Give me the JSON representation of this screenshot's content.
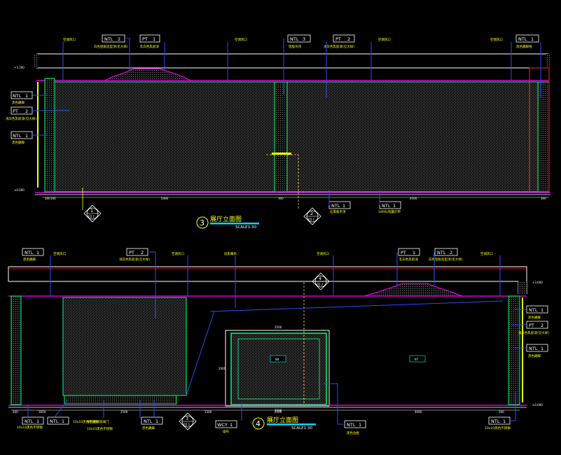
{
  "elevation_3": {
    "title": "展厅立面图",
    "number": "3",
    "scale": "SCALE1:30",
    "level_top": "+3.300",
    "level_base": "±0.000",
    "tags": [
      {
        "code": "NTL",
        "num": "2",
        "note": "白色铝板造型顶(见大样)"
      },
      {
        "code": "PT",
        "num": "1",
        "note": "乳白色乳胶漆"
      },
      {
        "code": "NTL",
        "num": "3",
        "note": "铝板吊顶"
      },
      {
        "code": "PT",
        "num": "2",
        "note": "浅灰色乳胶漆(见大样)"
      },
      {
        "code": "NTL",
        "num": "1",
        "note": "黑色踢脚线"
      }
    ],
    "left_tags": [
      {
        "code": "NTL",
        "num": "1",
        "note": "黑色踢脚"
      },
      {
        "code": "PT",
        "num": "2",
        "note": "浅灰色乳胶漆(见大样)"
      },
      {
        "code": "NTL",
        "num": "1",
        "note": "黑色踢脚"
      }
    ],
    "top_notes": [
      "空调风口",
      "空调风口",
      "空调风口",
      "空调风口"
    ],
    "dims": [
      "200",
      "100",
      "5400",
      "300",
      "4500",
      "300"
    ],
    "bottom_tags": [
      {
        "code": "NTL",
        "num": "1",
        "note": "石膏板吊顶"
      }
    ],
    "bottom_notes": [
      "1800L暗藏灯带"
    ],
    "details": [
      {
        "num": "1",
        "sheet": "FD.1"
      },
      {
        "num": "2",
        "sheet": "FD.1"
      }
    ]
  },
  "elevation_4": {
    "title": "展厅立面图",
    "number": "4",
    "scale": "SCALE1:30",
    "level_top": "+3.000",
    "level_base": "±0.000",
    "tags": [
      {
        "code": "NTL",
        "num": "1",
        "note": "黑色踢脚"
      },
      {
        "code": "PT",
        "num": "2",
        "note": "浅灰色乳胶漆(见大样)"
      },
      {
        "code": "PT",
        "num": "1",
        "note": "乳白色乳胶漆"
      },
      {
        "code": "NTL",
        "num": "2",
        "note": "白色铝板造型顶(见大样)"
      }
    ],
    "top_notes": [
      "空调风口",
      "空调风口",
      "投影幕布",
      "空调风口",
      "空调风口"
    ],
    "right_tags": [
      {
        "code": "NTL",
        "num": "1",
        "note": "黑色踢脚"
      },
      {
        "code": "PT",
        "num": "2",
        "note": "浅灰色乳胶漆(见大样)"
      },
      {
        "code": "NTL",
        "num": "1",
        "note": "黑色踢脚"
      }
    ],
    "dims": [
      "200",
      "1850",
      "2500",
      "1300",
      "2500",
      "4000",
      "200"
    ],
    "bottom_tags": [
      {
        "code": "NTL",
        "num": "1",
        "note": "10x10黑色不锈钢"
      },
      {
        "code": "NTL",
        "num": "1",
        "note": "10x10黑色不锈钢"
      },
      {
        "code": "NTL",
        "num": "1",
        "note": "黑色踢脚"
      },
      {
        "code": "WCY",
        "num": "1",
        "note": "墙布"
      },
      {
        "code": "NTL",
        "num": "1",
        "note": "黑色边框"
      },
      {
        "code": "NTL",
        "num": "1",
        "note": "10x10黑色不锈钢"
      }
    ],
    "bottom_notes": [
      "钢化磨砂玻璃门",
      "10x10黑色不锈钢"
    ],
    "center_labels": [
      "98",
      "97"
    ],
    "frame_dims": [
      "2500",
      "2500",
      "2000"
    ],
    "details": [
      {
        "num": "3",
        "sheet": "FD.1"
      },
      {
        "num": "4",
        "sheet": "FD.2"
      }
    ]
  },
  "colors": {
    "background": "#000000",
    "ceiling": "#ff00ff",
    "floor": "#ff00ff",
    "wall": "#ffffff",
    "leader": "#2a4bff",
    "panel_edge": "#00ff88",
    "text": "#ffff00",
    "title_underline": "#00d8ff",
    "column": "#00ff66",
    "hatch": "#3a3a3a"
  }
}
